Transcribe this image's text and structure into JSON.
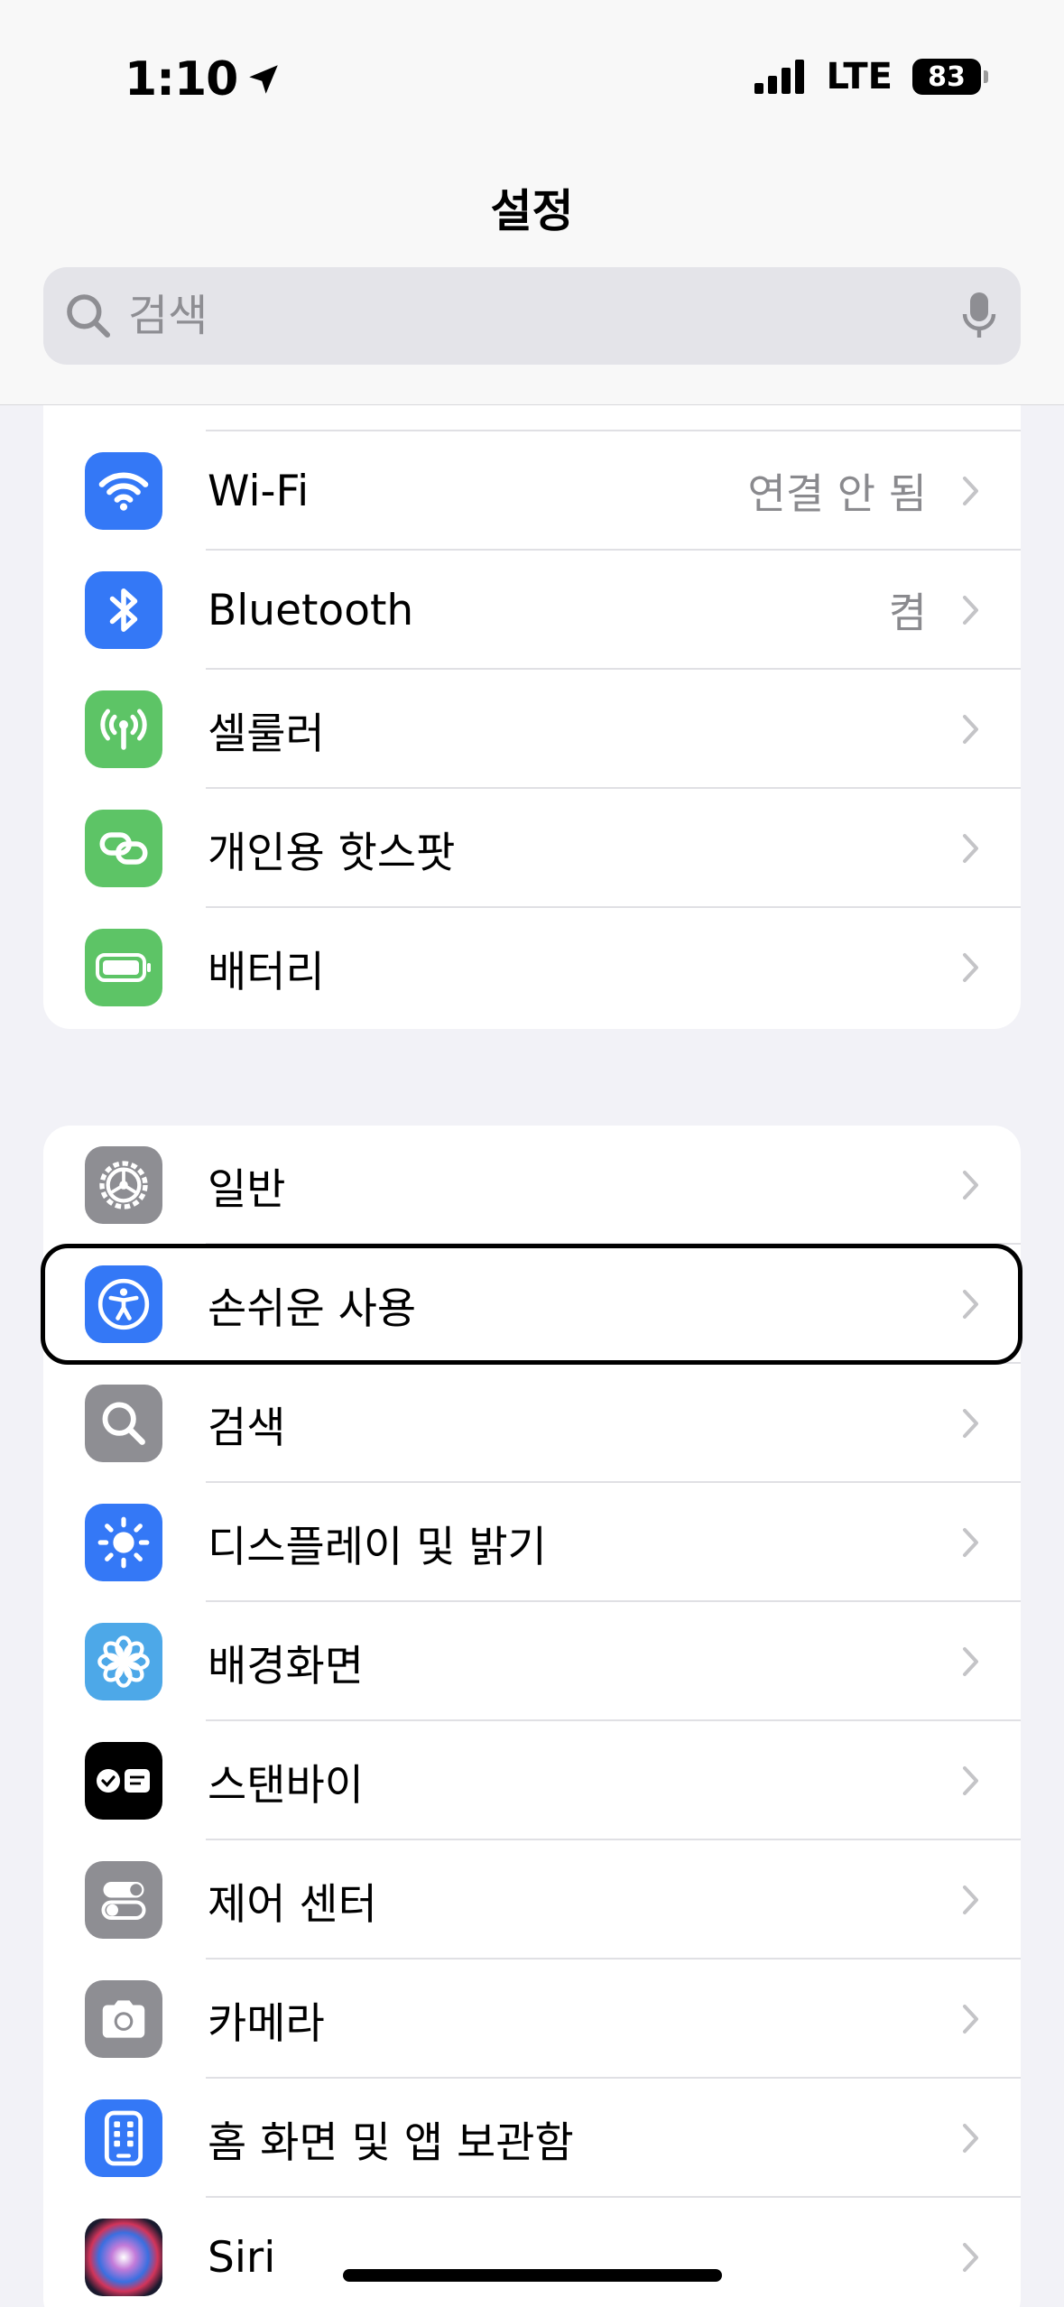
{
  "status_bar": {
    "time": "1:10",
    "network": "LTE",
    "battery": "83"
  },
  "nav": {
    "title": "설정"
  },
  "search": {
    "placeholder": "검색"
  },
  "group1": [
    {
      "label": "Wi-Fi",
      "value": "연결 안 됨",
      "icon": "wifi-icon",
      "color": "#3478F6"
    },
    {
      "label": "Bluetooth",
      "value": "켬",
      "icon": "bluetooth-icon",
      "color": "#3478F6"
    },
    {
      "label": "셀룰러",
      "value": "",
      "icon": "antenna-icon",
      "color": "#5DC466"
    },
    {
      "label": "개인용 핫스팟",
      "value": "",
      "icon": "hotspot-chain-icon",
      "color": "#5DC466"
    },
    {
      "label": "배터리",
      "value": "",
      "icon": "battery-icon",
      "color": "#5DC466"
    }
  ],
  "group2": [
    {
      "label": "일반",
      "icon": "gear-icon",
      "color": "#8E8E93"
    },
    {
      "label": "손쉬운 사용",
      "icon": "accessibility-icon",
      "color": "#3478F6",
      "focused": true
    },
    {
      "label": "검색",
      "icon": "search-icon",
      "color": "#8E8E93"
    },
    {
      "label": "디스플레이 및 밝기",
      "icon": "brightness-icon",
      "color": "#3478F6"
    },
    {
      "label": "배경화면",
      "icon": "flower-icon",
      "color": "#4DA8E8"
    },
    {
      "label": "스탠바이",
      "icon": "standby-icon",
      "color": "#000000"
    },
    {
      "label": "제어 센터",
      "icon": "toggles-icon",
      "color": "#8E8E93"
    },
    {
      "label": "카메라",
      "icon": "camera-icon",
      "color": "#8E8E93"
    },
    {
      "label": "홈 화면 및 앱 보관함",
      "icon": "home-screen-icon",
      "color": "#3478F6"
    },
    {
      "label": "Siri",
      "icon": "siri-icon",
      "color": "#1A1A2E"
    }
  ]
}
